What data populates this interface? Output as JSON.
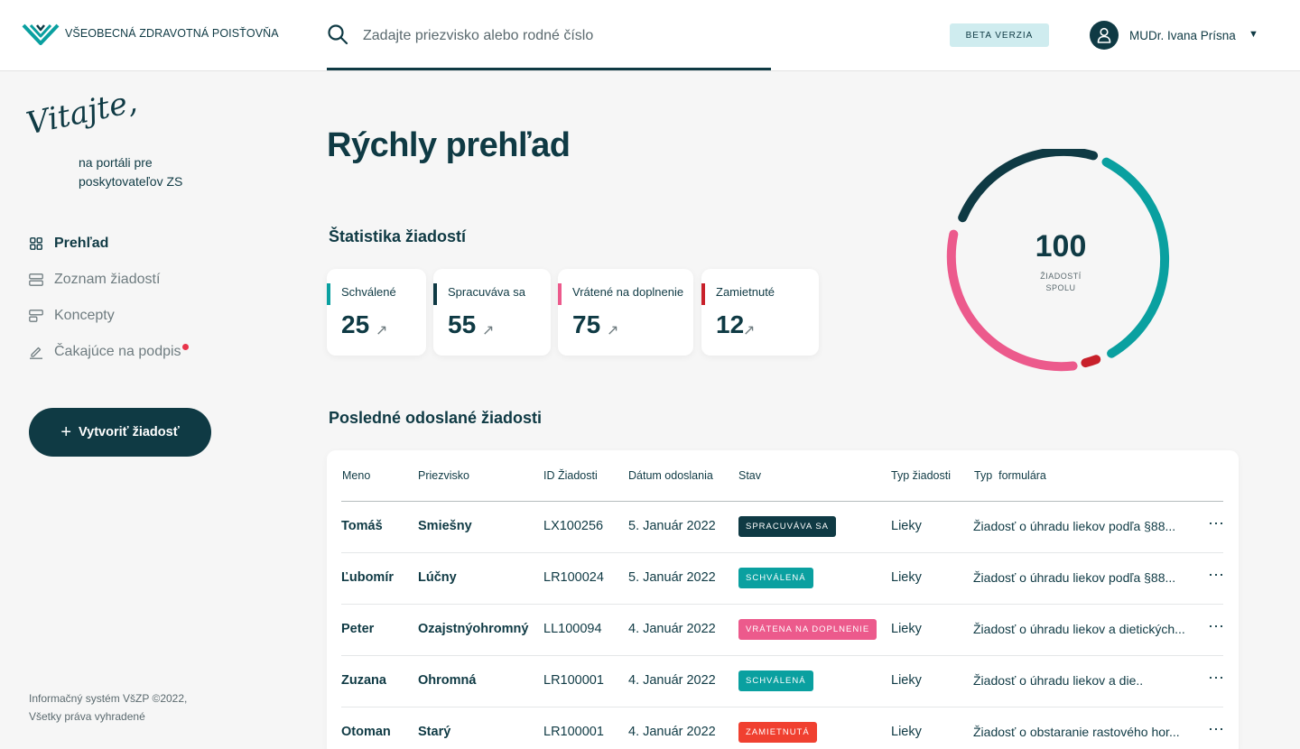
{
  "header": {
    "logo_text": "VŠEOBECNÁ ZDRAVOTNÁ POISŤOVŇA",
    "search_placeholder": "Zadajte priezvisko alebo rodné číslo",
    "beta_badge": "BETA VERZIA",
    "user_name": "MUDr. Ivana Prísna"
  },
  "sidebar": {
    "welcome_script": "Vitajte,",
    "welcome_sub": "na portáli pre poskytovateľov ZS",
    "nav": [
      {
        "label": "Prehľad",
        "icon": "grid-icon",
        "active": true
      },
      {
        "label": "Zoznam žiadostí",
        "icon": "list-icon",
        "active": false
      },
      {
        "label": "Koncepty",
        "icon": "drafts-icon",
        "active": false
      },
      {
        "label": "Čakajúce na podpis",
        "icon": "pen-icon",
        "active": false,
        "notification": true
      }
    ],
    "create_button": "Vytvoriť žiadosť",
    "footer_line1": "Informačný systém VšZP ©2022,",
    "footer_line2": "Všetky práva vyhradené"
  },
  "main": {
    "title": "Rýchly prehľad",
    "stats_title": "Štatistika žiadostí",
    "stats": [
      {
        "label": "Schválené",
        "value": "25",
        "color": "#0aa0a0"
      },
      {
        "label": "Spracuváva sa",
        "value": "55",
        "color": "#0f3a44"
      },
      {
        "label": "Vrátené na doplnenie",
        "value": "75",
        "color": "#ec5a8c"
      },
      {
        "label": "Zamietnuté",
        "value": "12",
        "color": "#c8202a"
      }
    ],
    "donut": {
      "total": "100",
      "sub_line1": "ŽIADOSTÍ",
      "sub_line2": "SPOLU"
    },
    "recent_title": "Posledné odoslané žiadosti",
    "table": {
      "headers": [
        "Meno",
        "Priezvisko",
        "ID Žiadosti",
        "Dátum odoslania",
        "Stav",
        "Typ žiadosti",
        "Typ  formulára"
      ],
      "rows": [
        {
          "meno": "Tomáš",
          "priezvisko": "Smiešny",
          "id": "LX100256",
          "datum": "5. Január 2022",
          "stav": "SPRACUVÁVA SA",
          "stav_color": "#0f3a44",
          "typ": "Lieky",
          "formular": "Žiadosť o úhradu liekov podľa §88..."
        },
        {
          "meno": "Ľubomír",
          "priezvisko": "Lúčny",
          "id": "LR100024",
          "datum": "5. Január 2022",
          "stav": "SCHVÁLENÁ",
          "stav_color": "#0aa0a0",
          "typ": "Lieky",
          "formular": "Žiadosť o úhradu liekov podľa §88..."
        },
        {
          "meno": "Peter",
          "priezvisko": "Ozajstnýohromný",
          "id": "LL100094",
          "datum": "4. Január 2022",
          "stav": "VRÁTENA NA DOPLNENIE",
          "stav_color": "#ec5a8c",
          "typ": "Lieky",
          "formular": "Žiadosť o úhradu liekov a dietických..."
        },
        {
          "meno": "Zuzana",
          "priezvisko": "Ohromná",
          "id": "LR100001",
          "datum": "4. Január 2022",
          "stav": "SCHVÁLENÁ",
          "stav_color": "#0aa0a0",
          "typ": "Lieky",
          "formular": "Žiadosť o úhradu liekov a die.."
        },
        {
          "meno": "Otoman",
          "priezvisko": "Starý",
          "id": "LR100001",
          "datum": "4. Január 2022",
          "stav": "ZAMIETNUTÁ",
          "stav_color": "#f04030",
          "typ": "Lieky",
          "formular": "Žiadosť o obstaranie rastového hor..."
        }
      ]
    }
  }
}
